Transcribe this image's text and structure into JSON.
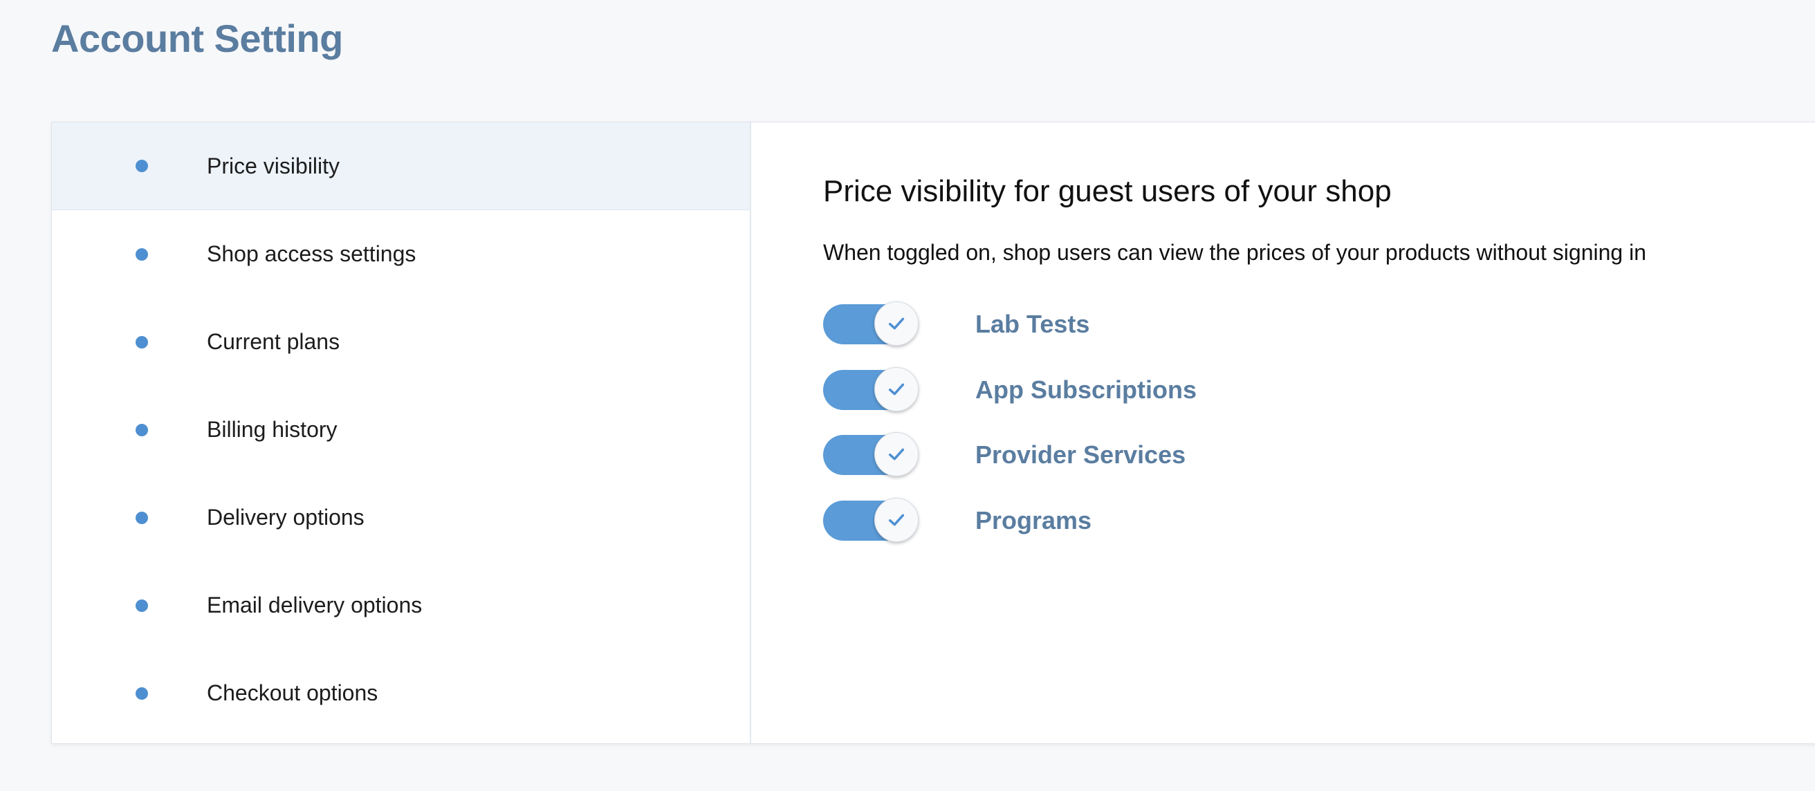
{
  "page": {
    "title": "Account Setting"
  },
  "sidebar": {
    "items": [
      {
        "label": "Price visibility",
        "active": true
      },
      {
        "label": "Shop access settings",
        "active": false
      },
      {
        "label": "Current plans",
        "active": false
      },
      {
        "label": "Billing history",
        "active": false
      },
      {
        "label": "Delivery options",
        "active": false
      },
      {
        "label": "Email delivery options",
        "active": false
      },
      {
        "label": "Checkout options",
        "active": false
      }
    ]
  },
  "content": {
    "title": "Price visibility for guest users of your shop",
    "description": "When toggled on, shop users can view the prices of your products without signing in",
    "toggles": [
      {
        "label": "Lab Tests",
        "checked": true
      },
      {
        "label": "App Subscriptions",
        "checked": true
      },
      {
        "label": "Provider Services",
        "checked": true
      },
      {
        "label": "Programs",
        "checked": true
      }
    ]
  },
  "colors": {
    "title": "#5a7da0",
    "accent": "#5b9bd7",
    "bullet": "#4e8fd1",
    "active_item_bg": "#eef3fa",
    "page_bg": "#f7f8fa"
  },
  "icons": {
    "bullet": "dot-icon",
    "toggle_check": "check-icon"
  }
}
